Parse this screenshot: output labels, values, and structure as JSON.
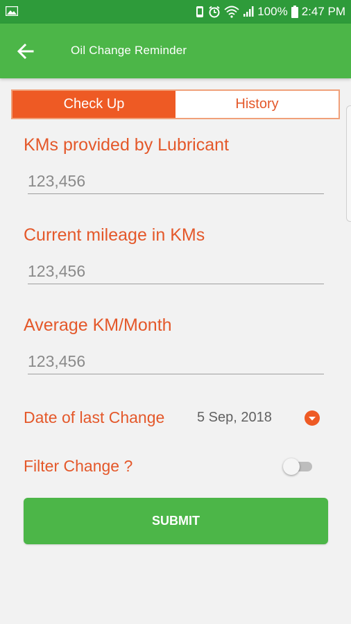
{
  "status_bar": {
    "battery": "100%",
    "time": "2:47 PM",
    "icons": [
      "image-icon",
      "vibrate-icon",
      "alarm-icon",
      "wifi-icon",
      "signal-icon",
      "battery-icon"
    ]
  },
  "app_bar": {
    "title": "Oil Change Reminder",
    "back_icon": "arrow-left-icon"
  },
  "tabs": [
    {
      "label": "Check Up",
      "active": true
    },
    {
      "label": "History",
      "active": false
    }
  ],
  "form": {
    "lubricant_km": {
      "label": "KMs provided by Lubricant",
      "placeholder": "123,456"
    },
    "current_mileage": {
      "label": "Current mileage in KMs",
      "placeholder": "123,456"
    },
    "avg_km_month": {
      "label": "Average KM/Month",
      "placeholder": "123,456"
    },
    "last_change": {
      "label": "Date of last Change",
      "value": "5 Sep, 2018",
      "icon": "chevron-down-circle-icon"
    },
    "filter_change": {
      "label": "Filter Change ?",
      "on": false
    }
  },
  "submit_label": "SUBMIT",
  "colors": {
    "status_bar": "#2e9b3a",
    "app_bar": "#4cb648",
    "accent": "#e4582a",
    "tab_active": "#ee5a24",
    "submit": "#4cb648",
    "background": "#f2f2f2"
  }
}
